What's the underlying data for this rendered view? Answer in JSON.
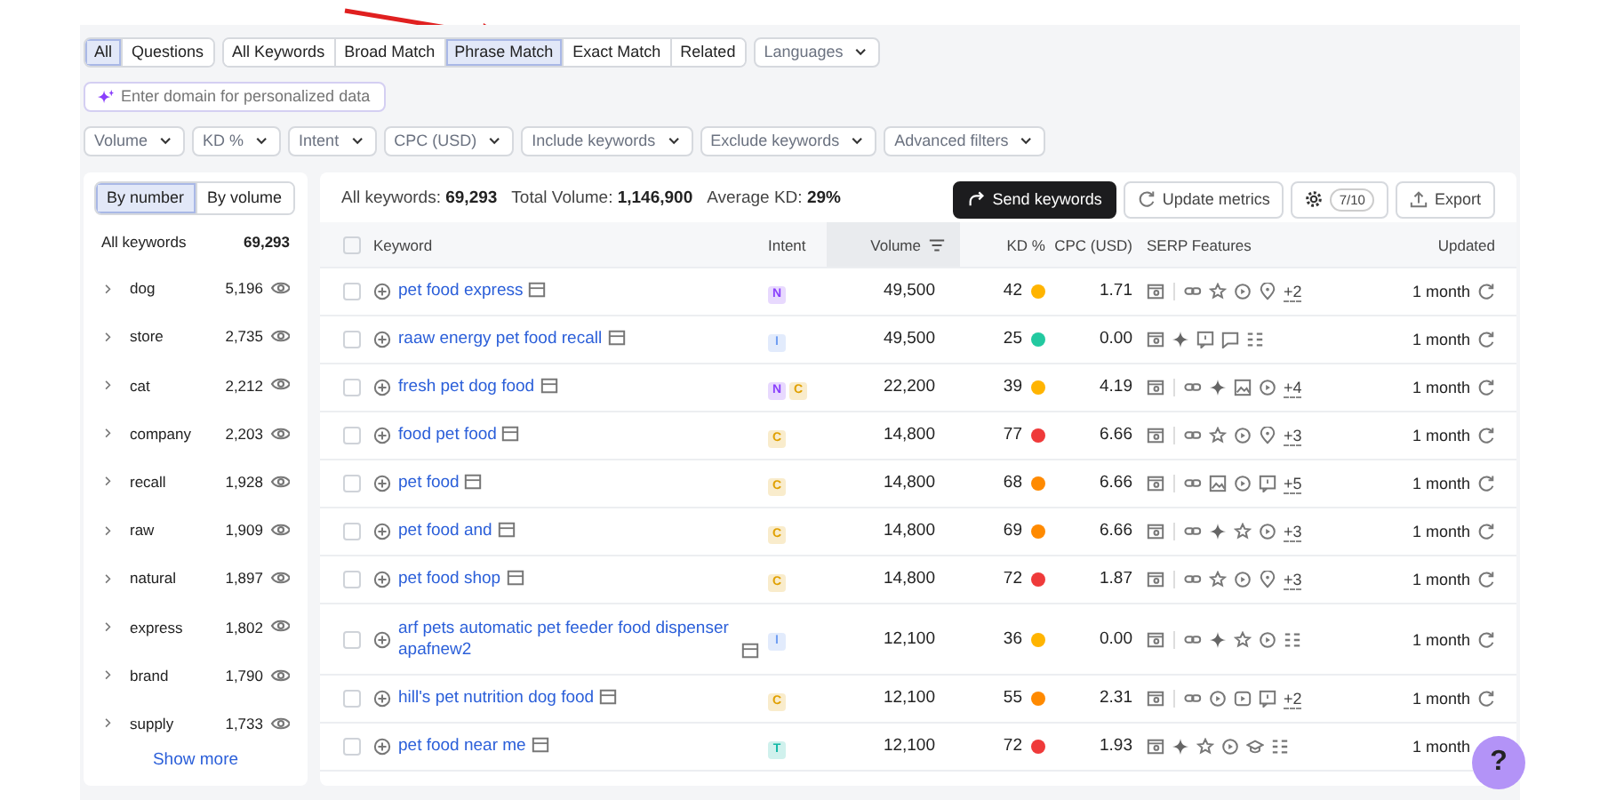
{
  "match_groups": [
    [
      {
        "label": "All",
        "selected": true
      },
      {
        "label": "Questions",
        "selected": false
      }
    ],
    [
      {
        "label": "All Keywords",
        "selected": false
      },
      {
        "label": "Broad Match",
        "selected": false
      },
      {
        "label": "Phrase Match",
        "selected": true
      },
      {
        "label": "Exact Match",
        "selected": false
      },
      {
        "label": "Related",
        "selected": false
      }
    ]
  ],
  "language_dropdown": "Languages",
  "domain_field": {
    "placeholder": "Enter domain for personalized data"
  },
  "filters": [
    "Volume",
    "KD %",
    "Intent",
    "CPC (USD)",
    "Include keywords",
    "Exclude keywords",
    "Advanced filters"
  ],
  "sidebar": {
    "toggle": [
      {
        "label": "By number",
        "selected": true
      },
      {
        "label": "By volume",
        "selected": false
      }
    ],
    "total": {
      "label": "All keywords",
      "count": "69,293"
    },
    "groups": [
      {
        "label": "dog",
        "count": "5,196"
      },
      {
        "label": "store",
        "count": "2,735"
      },
      {
        "label": "cat",
        "count": "2,212"
      },
      {
        "label": "company",
        "count": "2,203"
      },
      {
        "label": "recall",
        "count": "1,928"
      },
      {
        "label": "raw",
        "count": "1,909"
      },
      {
        "label": "natural",
        "count": "1,897"
      },
      {
        "label": "express",
        "count": "1,802"
      },
      {
        "label": "brand",
        "count": "1,790"
      },
      {
        "label": "supply",
        "count": "1,733"
      }
    ],
    "show_more": "Show more"
  },
  "summary": [
    {
      "label": "All keywords:",
      "value": "69,293"
    },
    {
      "label": "Total Volume:",
      "value": "1,146,900"
    },
    {
      "label": "Average KD:",
      "value": "29%"
    }
  ],
  "toolbar": {
    "send": "Send keywords",
    "update": "Update metrics",
    "limit": "7/10",
    "export": "Export"
  },
  "select_all": {
    "checked": false
  },
  "columns": [
    "Keyword",
    "Intent",
    "Volume",
    "KD %",
    "CPC (USD)",
    "SERP Features",
    "Updated"
  ],
  "rows": [
    {
      "checked": false,
      "keyword": "pet food express",
      "intent": [
        {
          "label": "N",
          "color": "#8a3ffc"
        }
      ],
      "volume": "49,500",
      "kd": {
        "value": "42",
        "color": "#ffb400"
      },
      "cpc": "1.71",
      "divider": true,
      "serp": [
        {
          "kind": "link"
        },
        {
          "kind": "star"
        },
        {
          "kind": "play"
        },
        {
          "kind": "pin"
        }
      ],
      "more": "+2",
      "updated": "1 month",
      "refresh": true
    },
    {
      "checked": false,
      "keyword": "raaw energy pet food recall",
      "intent": [
        {
          "label": "I",
          "color": "#6f9df2"
        }
      ],
      "volume": "49,500",
      "kd": {
        "value": "25",
        "color": "#22c9a0"
      },
      "cpc": "0.00",
      "divider": false,
      "serp": [
        {
          "kind": "sparkle"
        },
        {
          "kind": "review"
        },
        {
          "kind": "comment"
        },
        {
          "kind": "list"
        }
      ],
      "updated": "1 month",
      "refresh": true
    },
    {
      "checked": false,
      "keyword": "fresh pet dog food",
      "intent": [
        {
          "label": "N",
          "color": "#8a3ffc"
        },
        {
          "label": "C",
          "color": "#e0a000"
        }
      ],
      "volume": "22,200",
      "kd": {
        "value": "39",
        "color": "#ffb400"
      },
      "cpc": "4.19",
      "divider": true,
      "serp": [
        {
          "kind": "link"
        },
        {
          "kind": "sparkle"
        },
        {
          "kind": "image"
        },
        {
          "kind": "play"
        }
      ],
      "more": "+4",
      "updated": "1 month",
      "refresh": true
    },
    {
      "checked": false,
      "keyword": "food pet food",
      "intent": [
        {
          "label": "C",
          "color": "#e0a000"
        }
      ],
      "volume": "14,800",
      "kd": {
        "value": "77",
        "color": "#ef3a3a"
      },
      "cpc": "6.66",
      "divider": true,
      "serp": [
        {
          "kind": "link"
        },
        {
          "kind": "star"
        },
        {
          "kind": "play"
        },
        {
          "kind": "pin"
        }
      ],
      "more": "+3",
      "updated": "1 month",
      "refresh": true
    },
    {
      "checked": false,
      "keyword": "pet food",
      "intent": [
        {
          "label": "C",
          "color": "#e0a000"
        }
      ],
      "volume": "14,800",
      "kd": {
        "value": "68",
        "color": "#ff8a00"
      },
      "cpc": "6.66",
      "divider": true,
      "serp": [
        {
          "kind": "link"
        },
        {
          "kind": "image"
        },
        {
          "kind": "play"
        },
        {
          "kind": "review"
        }
      ],
      "more": "+5",
      "updated": "1 month",
      "refresh": true
    },
    {
      "checked": false,
      "keyword": "pet food and",
      "intent": [
        {
          "label": "C",
          "color": "#e0a000"
        }
      ],
      "volume": "14,800",
      "kd": {
        "value": "69",
        "color": "#ff8a00"
      },
      "cpc": "6.66",
      "divider": true,
      "serp": [
        {
          "kind": "link"
        },
        {
          "kind": "sparkle"
        },
        {
          "kind": "star"
        },
        {
          "kind": "play"
        }
      ],
      "more": "+3",
      "updated": "1 month",
      "refresh": true
    },
    {
      "checked": false,
      "keyword": "pet food shop",
      "intent": [
        {
          "label": "C",
          "color": "#e0a000"
        }
      ],
      "volume": "14,800",
      "kd": {
        "value": "72",
        "color": "#ef3a3a"
      },
      "cpc": "1.87",
      "divider": true,
      "serp": [
        {
          "kind": "link"
        },
        {
          "kind": "star"
        },
        {
          "kind": "play"
        },
        {
          "kind": "pin"
        }
      ],
      "more": "+3",
      "updated": "1 month",
      "refresh": true
    },
    {
      "checked": false,
      "keyword": "arf pets automatic pet feeder food dispenser apafnew2",
      "intent": [
        {
          "label": "I",
          "color": "#6f9df2"
        }
      ],
      "volume": "12,100",
      "kd": {
        "value": "36",
        "color": "#ffb400"
      },
      "cpc": "0.00",
      "divider": true,
      "serp": [
        {
          "kind": "link"
        },
        {
          "kind": "sparkle"
        },
        {
          "kind": "star"
        },
        {
          "kind": "play"
        },
        {
          "kind": "list"
        }
      ],
      "updated": "1 month",
      "refresh": true
    },
    {
      "checked": false,
      "keyword": "hill's pet nutrition dog food",
      "intent": [
        {
          "label": "C",
          "color": "#e0a000"
        }
      ],
      "volume": "12,100",
      "kd": {
        "value": "55",
        "color": "#ff8a00"
      },
      "cpc": "2.31",
      "divider": true,
      "serp": [
        {
          "kind": "link"
        },
        {
          "kind": "play"
        },
        {
          "kind": "video"
        },
        {
          "kind": "review"
        }
      ],
      "more": "+2",
      "updated": "1 month",
      "refresh": true
    },
    {
      "checked": false,
      "keyword": "pet food near me",
      "intent": [
        {
          "label": "T",
          "color": "#14b8a6"
        }
      ],
      "volume": "12,100",
      "kd": {
        "value": "72",
        "color": "#ef3a3a"
      },
      "cpc": "1.93",
      "divider": false,
      "serp": [
        {
          "kind": "sparkle"
        },
        {
          "kind": "star"
        },
        {
          "kind": "play"
        },
        {
          "kind": "cap"
        },
        {
          "kind": "list"
        }
      ],
      "updated": "1 month",
      "refresh": false
    }
  ],
  "help_button": "?"
}
